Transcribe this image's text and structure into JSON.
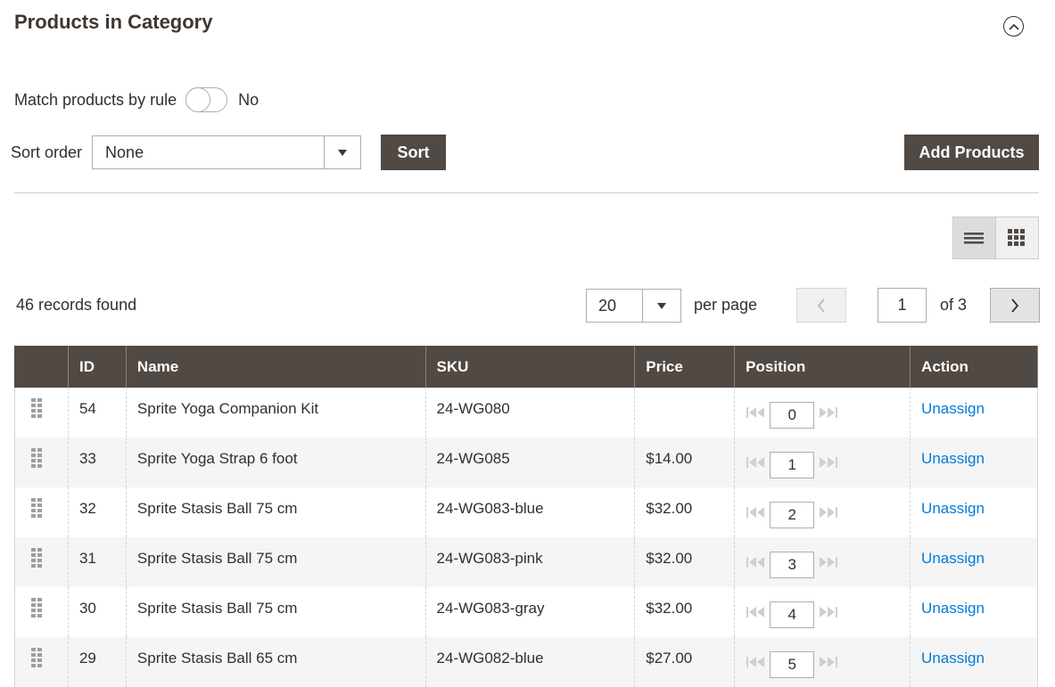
{
  "section": {
    "title": "Products in Category"
  },
  "match_rule": {
    "label": "Match products by rule",
    "value": "No",
    "enabled": false
  },
  "sort": {
    "label": "Sort order",
    "selected": "None",
    "button_label": "Sort"
  },
  "add_products_label": "Add Products",
  "grid": {
    "records_text": "46 records found",
    "per_page_value": "20",
    "per_page_label": "per page",
    "current_page": "1",
    "page_total_text": "of 3",
    "columns": [
      "",
      "ID",
      "Name",
      "SKU",
      "Price",
      "Position",
      "Action"
    ],
    "rows": [
      {
        "id": "54",
        "name": "Sprite Yoga Companion Kit",
        "sku": "24-WG080",
        "price": "",
        "position": "0",
        "action": "Unassign"
      },
      {
        "id": "33",
        "name": "Sprite Yoga Strap 6 foot",
        "sku": "24-WG085",
        "price": "$14.00",
        "position": "1",
        "action": "Unassign"
      },
      {
        "id": "32",
        "name": "Sprite Stasis Ball 75 cm",
        "sku": "24-WG083-blue",
        "price": "$32.00",
        "position": "2",
        "action": "Unassign"
      },
      {
        "id": "31",
        "name": "Sprite Stasis Ball 75 cm",
        "sku": "24-WG083-pink",
        "price": "$32.00",
        "position": "3",
        "action": "Unassign"
      },
      {
        "id": "30",
        "name": "Sprite Stasis Ball 75 cm",
        "sku": "24-WG083-gray",
        "price": "$32.00",
        "position": "4",
        "action": "Unassign"
      },
      {
        "id": "29",
        "name": "Sprite Stasis Ball 65 cm",
        "sku": "24-WG082-blue",
        "price": "$27.00",
        "position": "5",
        "action": "Unassign"
      }
    ]
  },
  "colors": {
    "header_bg": "#514943",
    "link": "#007bdb",
    "button_dark": "#514943"
  },
  "icons": {
    "collapse": "chevron-up-circle-icon",
    "list_view": "list-view-icon",
    "grid_view": "grid-view-icon",
    "drag": "drag-handle-icon",
    "prev": "chevron-left-icon",
    "next": "chevron-right-icon",
    "move_top": "move-first-icon",
    "move_bottom": "move-last-icon"
  }
}
